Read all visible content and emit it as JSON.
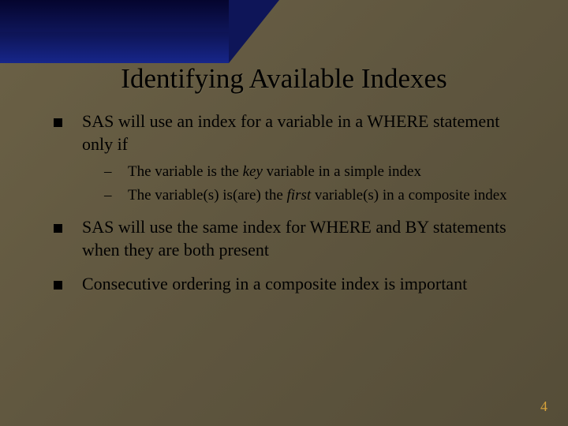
{
  "slide": {
    "title": "Identifying Available Indexes",
    "page_number": "4"
  },
  "bullets": {
    "b1": {
      "text": "SAS will use an index for a variable in a WHERE statement only if",
      "sub1_pre": "The variable is the ",
      "sub1_em": "key",
      "sub1_post": " variable in a simple index",
      "sub2_pre": "The variable(s) is(are) the ",
      "sub2_em": "first",
      "sub2_post": " variable(s) in a composite index"
    },
    "b2": {
      "text": "SAS will use the same index for WHERE and BY statements when they are both present"
    },
    "b3": {
      "text": "Consecutive ordering in a composite index is important"
    }
  }
}
